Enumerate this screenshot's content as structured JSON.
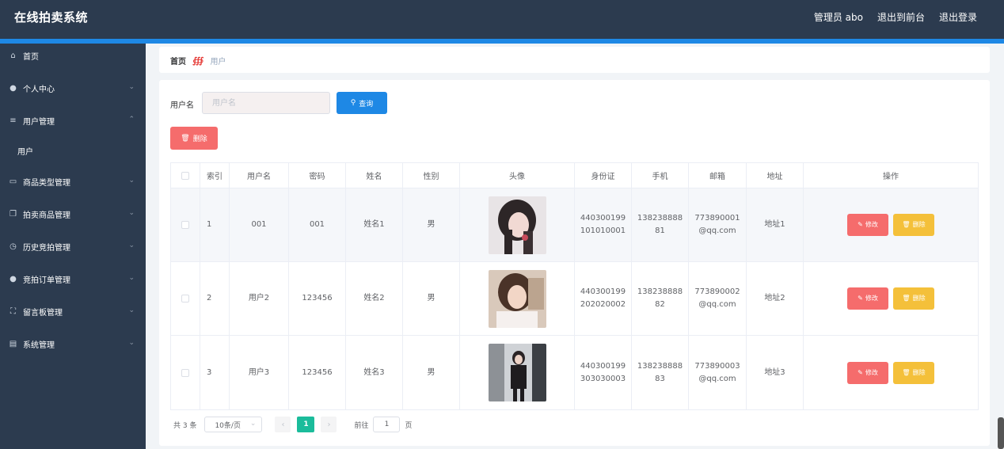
{
  "header": {
    "title": "在线拍卖系统",
    "user_label": "管理员 abo",
    "to_front": "退出到前台",
    "logout": "退出登录"
  },
  "sidebar": {
    "items": [
      {
        "label": "首页",
        "icon": "home-icon"
      },
      {
        "label": "个人中心",
        "icon": "user-icon"
      },
      {
        "label": "用户管理",
        "icon": "sliders-icon"
      },
      {
        "label": "用户",
        "icon": ""
      },
      {
        "label": "商品类型管理",
        "icon": "monitor-icon"
      },
      {
        "label": "拍卖商品管理",
        "icon": "copy-icon"
      },
      {
        "label": "历史竞拍管理",
        "icon": "clock-icon"
      },
      {
        "label": "竞拍订单管理",
        "icon": "user-cart-icon"
      },
      {
        "label": "留言板管理",
        "icon": "frame-icon"
      },
      {
        "label": "系统管理",
        "icon": "clipboard-icon"
      }
    ]
  },
  "breadcrumb": {
    "home": "首页",
    "current": "用户"
  },
  "search": {
    "label": "用户名",
    "placeholder": "用户名",
    "button": "查询"
  },
  "toolbar": {
    "delete_label": "删除"
  },
  "table": {
    "headers": [
      "索引",
      "用户名",
      "密码",
      "姓名",
      "性别",
      "头像",
      "身份证",
      "手机",
      "邮箱",
      "地址",
      "操作"
    ],
    "rows": [
      {
        "index": "1",
        "username": "001",
        "password": "001",
        "name": "姓名1",
        "gender": "男",
        "id1": "440300199",
        "id2": "101010001",
        "phone1": "138238888",
        "phone2": "81",
        "email1": "773890001",
        "email2": "@qq.com",
        "address": "地址1"
      },
      {
        "index": "2",
        "username": "用户2",
        "password": "123456",
        "name": "姓名2",
        "gender": "男",
        "id1": "440300199",
        "id2": "202020002",
        "phone1": "138238888",
        "phone2": "82",
        "email1": "773890002",
        "email2": "@qq.com",
        "address": "地址2"
      },
      {
        "index": "3",
        "username": "用户3",
        "password": "123456",
        "name": "姓名3",
        "gender": "男",
        "id1": "440300199",
        "id2": "303030003",
        "phone1": "138238888",
        "phone2": "83",
        "email1": "773890003",
        "email2": "@qq.com",
        "address": "地址3"
      }
    ],
    "edit_label": "修改",
    "delete_label": "删除"
  },
  "pagination": {
    "total": "共 3 条",
    "page_size": "10条/页",
    "current_page": "1",
    "goto_label": "前往",
    "goto_value": "1",
    "page_suffix": "页"
  },
  "colors": {
    "header_bg": "#2c3b4f",
    "accent_blue": "#1e88e5",
    "danger": "#f56c6c",
    "warning": "#f4c03a",
    "page_active": "#1bbc9b"
  }
}
